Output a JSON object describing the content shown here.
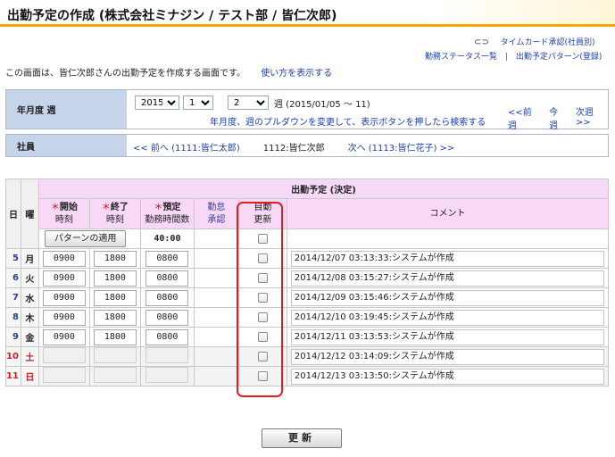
{
  "title": "出勤予定の作成 (株式会社ミナジン / テスト部 / 皆仁次郎)",
  "toplinks": {
    "key_icon": "⊂⊃",
    "timecard": "タイムカード承認(社員別)",
    "status_list": "勤務ステータス一覧",
    "separator": "|",
    "pattern_register": "出勤予定パターン(登録)"
  },
  "intro": {
    "text": "この画面は、皆仁次郎さんの出勤予定を作成する画面です。",
    "howto_link": "使い方を表示する"
  },
  "period": {
    "label": "年月度 週",
    "year": "2015",
    "month": "1",
    "week": "2",
    "week_suffix": "週 (2015/01/05 ～ 11)",
    "hint": "年月度、週のプルダウンを変更して、表示ボタンを押したら検索する",
    "prev_week": "<<前週",
    "this_week": "今週",
    "next_week": "次週>>"
  },
  "employee": {
    "label": "社員",
    "prev": "<< 前へ (1111:皆仁太郎)",
    "current": "1112:皆仁次郎",
    "next": "次へ (1113:皆仁花子) >>"
  },
  "grid": {
    "col_day": "日",
    "col_dow": "曜",
    "section_title": "出勤予定 (決定)",
    "req_mark": "＊",
    "start_label1": "開始",
    "start_label2": "時刻",
    "end_label1": "終了",
    "end_label2": "時刻",
    "planned_label1": "預定",
    "planned_label2": "勤務時間数",
    "approval_label1": "勤怠",
    "approval_label2": "承認",
    "auto_label1": "自動",
    "auto_label2": "更新",
    "comment_label": "コメント",
    "pattern_button": "パターンの適用",
    "total_hours": "40:00",
    "rows": [
      {
        "day": "5",
        "dow": "月",
        "start": "0900",
        "end": "1800",
        "planned": "0800",
        "comment": "2014/12/07 03:13:33:システムが作成"
      },
      {
        "day": "6",
        "dow": "火",
        "start": "0900",
        "end": "1800",
        "planned": "0800",
        "comment": "2014/12/08 03:15:27:システムが作成"
      },
      {
        "day": "7",
        "dow": "水",
        "start": "0900",
        "end": "1800",
        "planned": "0800",
        "comment": "2014/12/09 03:15:46:システムが作成"
      },
      {
        "day": "8",
        "dow": "木",
        "start": "0900",
        "end": "1800",
        "planned": "0800",
        "comment": "2014/12/10 03:19:45:システムが作成"
      },
      {
        "day": "9",
        "dow": "金",
        "start": "0900",
        "end": "1800",
        "planned": "0800",
        "comment": "2014/12/11 03:13:53:システムが作成"
      },
      {
        "day": "10",
        "dow": "土",
        "start": "",
        "end": "",
        "planned": "",
        "comment": "2014/12/12 03:14:09:システムが作成"
      },
      {
        "day": "11",
        "dow": "日",
        "start": "",
        "end": "",
        "planned": "",
        "comment": "2014/12/13 03:13:50:システムが作成"
      }
    ]
  },
  "update_button": "更新",
  "colors": {
    "accent_underline": "#f2a900",
    "panel_label_bg": "#c6d4ea",
    "pink_header": "#f7d8f7",
    "highlight": "#e02020",
    "weekend_text": "#d02020",
    "link": "#1a3fb5"
  }
}
